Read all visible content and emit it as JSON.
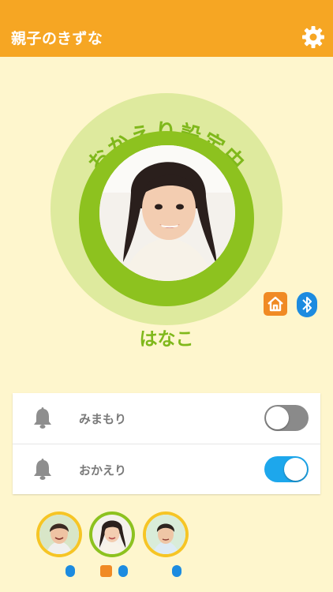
{
  "header": {
    "title": "親子のきずな",
    "settings_icon": "gear-icon"
  },
  "status": {
    "arc_text": "おかえり設定中",
    "child_name": "はなこ",
    "badges": [
      "home-icon",
      "bluetooth-icon"
    ]
  },
  "settings": {
    "rows": [
      {
        "label": "みまもり",
        "icon": "bell-icon",
        "enabled": false
      },
      {
        "label": "おかえり",
        "icon": "bell-icon",
        "enabled": true
      }
    ]
  },
  "children": [
    {
      "selected": false,
      "ring_color": "#F6C525",
      "badges": [
        "bluetooth-icon"
      ]
    },
    {
      "selected": true,
      "ring_color": "#8DC21F",
      "badges": [
        "home-icon",
        "bluetooth-icon"
      ]
    },
    {
      "selected": false,
      "ring_color": "#F6C525",
      "badges": [
        "bluetooth-icon"
      ]
    }
  ],
  "colors": {
    "header": "#F6A623",
    "background": "#FEF6CD",
    "accent_green": "#8DC21F",
    "toggle_on": "#1DA7EC",
    "home_badge": "#F08A24",
    "bluetooth_badge": "#1C8BE0"
  }
}
